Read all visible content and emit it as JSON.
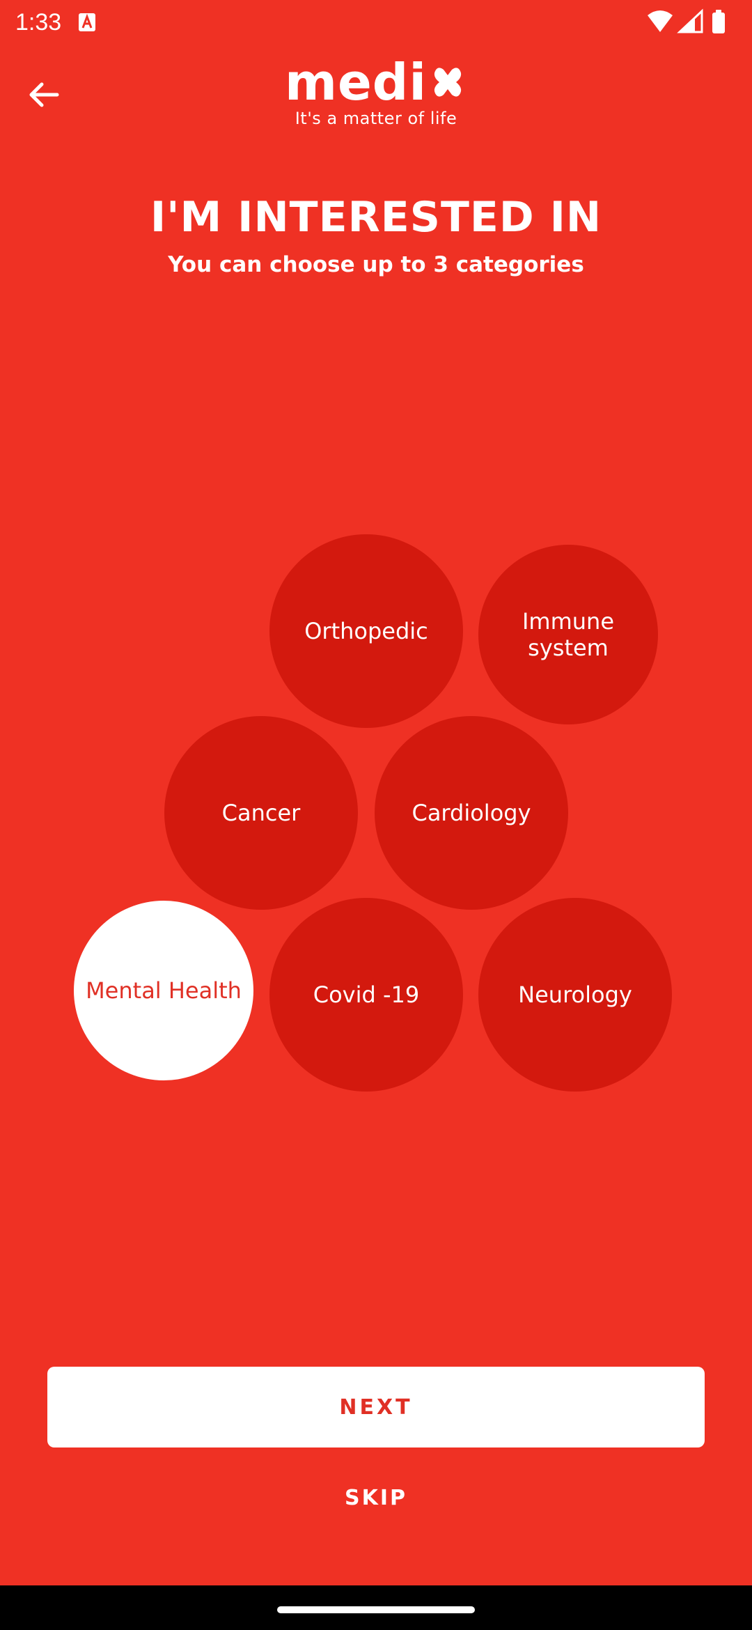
{
  "status_bar": {
    "time": "1:33"
  },
  "header": {
    "back_label": "back",
    "logo_text": "medi",
    "tagline": "It's a matter of life"
  },
  "main": {
    "title": "I'M INTERESTED IN",
    "subtitle": "You can choose up to 3 categories",
    "categories": [
      {
        "label": "Orthopedic",
        "selected": false
      },
      {
        "label": "Immune\nsystem",
        "selected": false
      },
      {
        "label": "Cancer",
        "selected": false
      },
      {
        "label": "Cardiology",
        "selected": false
      },
      {
        "label": "Mental Health",
        "selected": true
      },
      {
        "label": "Covid -19",
        "selected": false
      },
      {
        "label": "Neurology",
        "selected": false
      }
    ]
  },
  "actions": {
    "next_label": "NEXT",
    "skip_label": "SKIP"
  },
  "colors": {
    "background": "#ef3124",
    "bubble": "#d3190e",
    "selected_bubble": "#ffffff",
    "accent_text": "#e03025"
  },
  "icons": {
    "back": "arrow-left-icon",
    "wifi": "wifi-icon",
    "signal": "signal-icon",
    "battery": "battery-icon"
  }
}
